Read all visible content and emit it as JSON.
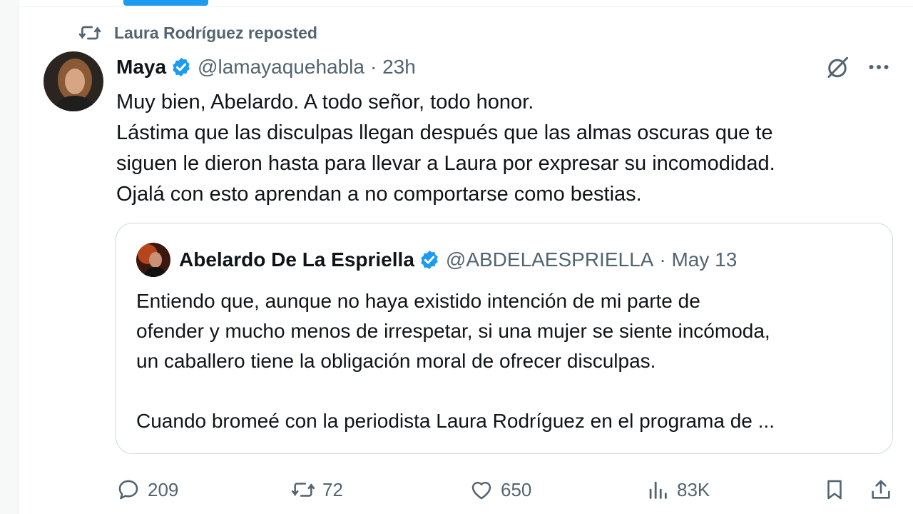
{
  "repost": {
    "label": "Laura Rodríguez reposted"
  },
  "tweet": {
    "author_name": "Maya",
    "author_handle": "@lamayaquehabla",
    "time": "· 23h",
    "lines": [
      "Muy bien, Abelardo. A todo señor, todo honor.",
      "Lástima que las disculpas llegan después que las almas oscuras que te",
      "siguen le dieron hasta para llevar a Laura por expresar su incomodidad.",
      "Ojalá con esto aprendan a no comportarse como bestias."
    ]
  },
  "quote": {
    "author_name": "Abelardo De La Espriella",
    "author_handle": "@ABDELAESPRIELLA",
    "time": "· May 13",
    "lines": [
      "Entiendo que, aunque no haya existido intención de mi parte de",
      "ofender y mucho menos de irrespetar, si una mujer se siente incómoda,",
      "un caballero tiene la obligación moral de ofrecer disculpas."
    ],
    "more_line": "Cuando bromeé con la periodista Laura Rodríguez en el programa de ..."
  },
  "metrics": {
    "replies": "209",
    "reposts": "72",
    "likes": "650",
    "views": "83K"
  },
  "icons": {
    "repost": "repost-icon",
    "verified": "verified-badge-icon",
    "grok": "grok-icon",
    "more": "more-icon",
    "reply": "reply-icon",
    "like": "heart-icon",
    "views": "views-icon",
    "bookmark": "bookmark-icon",
    "share": "share-icon"
  },
  "colors": {
    "accent": "#1d9bf0",
    "text": "#0f1419",
    "secondary": "#536471",
    "border": "#cfd9de"
  }
}
